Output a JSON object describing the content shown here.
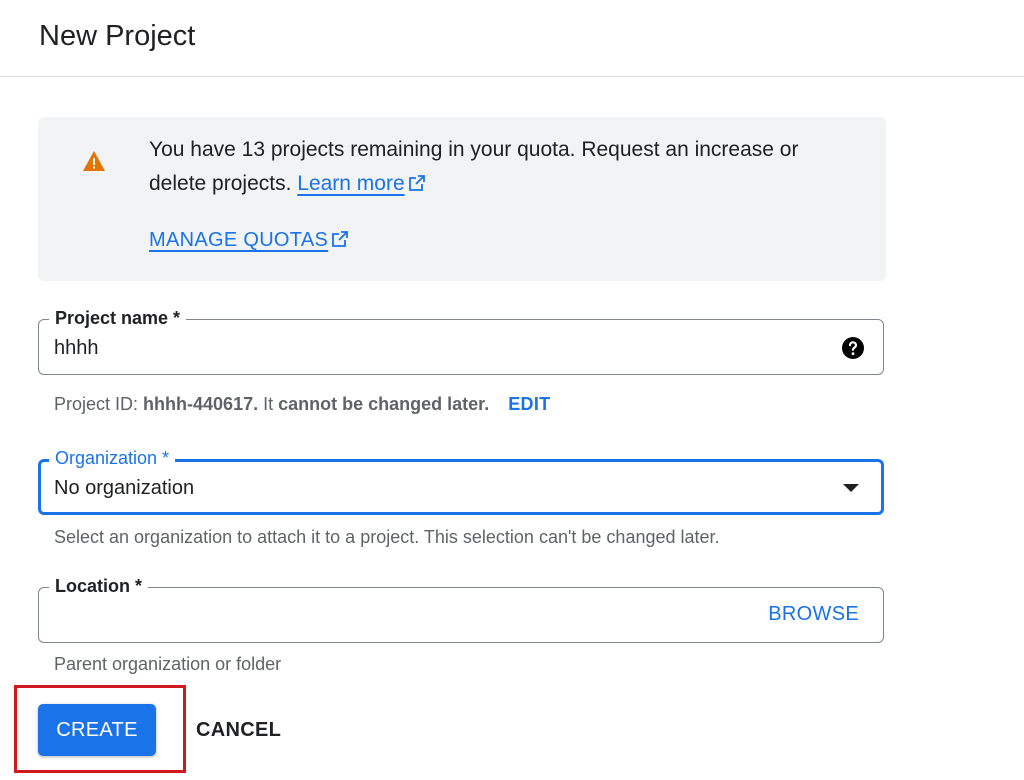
{
  "page": {
    "title": "New Project"
  },
  "notice": {
    "icon": "warning-icon",
    "text_part1": "You have 13 projects remaining in your quota. Request an increase or delete projects.",
    "learn_more": "Learn more",
    "manage_quotas": "MANAGE QUOTAS",
    "warning_color": "#e37400"
  },
  "project_name": {
    "label": "Project name *",
    "value": "hhhh",
    "help_icon": "help-icon",
    "id_prefix": "Project ID:",
    "id_value": "hhhh-440617.",
    "id_mid": "It",
    "id_warning": "cannot be changed later.",
    "edit": "EDIT"
  },
  "organization": {
    "label": "Organization *",
    "value": "No organization",
    "hint": "Select an organization to attach it to a project. This selection can't be changed later."
  },
  "location": {
    "label": "Location *",
    "value": "",
    "browse": "BROWSE",
    "hint": "Parent organization or folder"
  },
  "actions": {
    "create": "CREATE",
    "cancel": "CANCEL"
  },
  "colors": {
    "accent": "#1a73e8",
    "highlight": "#d0191f"
  }
}
